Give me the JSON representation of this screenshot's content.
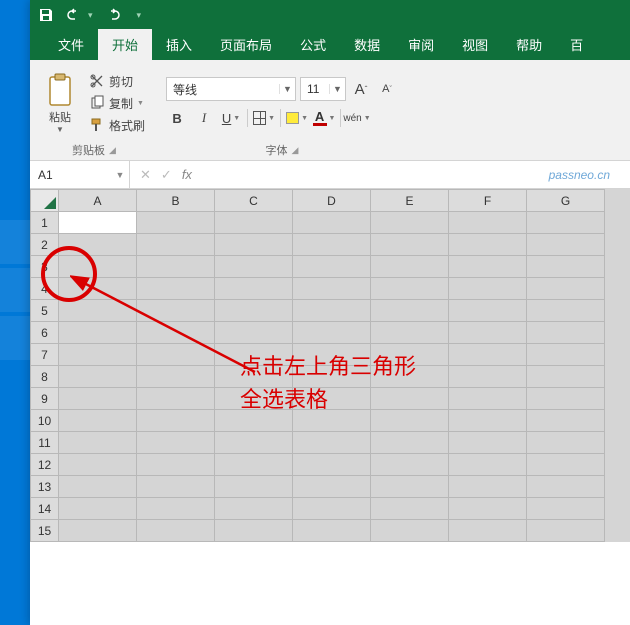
{
  "qat": {
    "save_title": "save",
    "undo_title": "undo",
    "redo_title": "redo"
  },
  "tabs": {
    "file": "文件",
    "home": "开始",
    "insert": "插入",
    "layout": "页面布局",
    "formula": "公式",
    "data": "数据",
    "review": "审阅",
    "view": "视图",
    "help": "帮助",
    "more": "百"
  },
  "clipboard": {
    "paste": "粘贴",
    "cut": "剪切",
    "copy": "复制",
    "format_painter": "格式刷",
    "group_label": "剪贴板"
  },
  "font": {
    "name": "等线",
    "size": "11",
    "increase": "A",
    "decrease": "A",
    "bold": "B",
    "italic": "I",
    "underline": "U",
    "wen": "wén",
    "group_label": "字体"
  },
  "name_box": {
    "value": "A1"
  },
  "fx": {
    "cancel": "✕",
    "confirm": "✓",
    "fx": "fx"
  },
  "watermark": "passneo.cn",
  "columns": [
    "A",
    "B",
    "C",
    "D",
    "E",
    "F",
    "G"
  ],
  "rows": [
    "1",
    "2",
    "3",
    "4",
    "5",
    "6",
    "7",
    "8",
    "9",
    "10",
    "11",
    "12",
    "13",
    "14",
    "15"
  ],
  "annotation": {
    "line1": "点击左上角三角形",
    "line2": "全选表格"
  }
}
